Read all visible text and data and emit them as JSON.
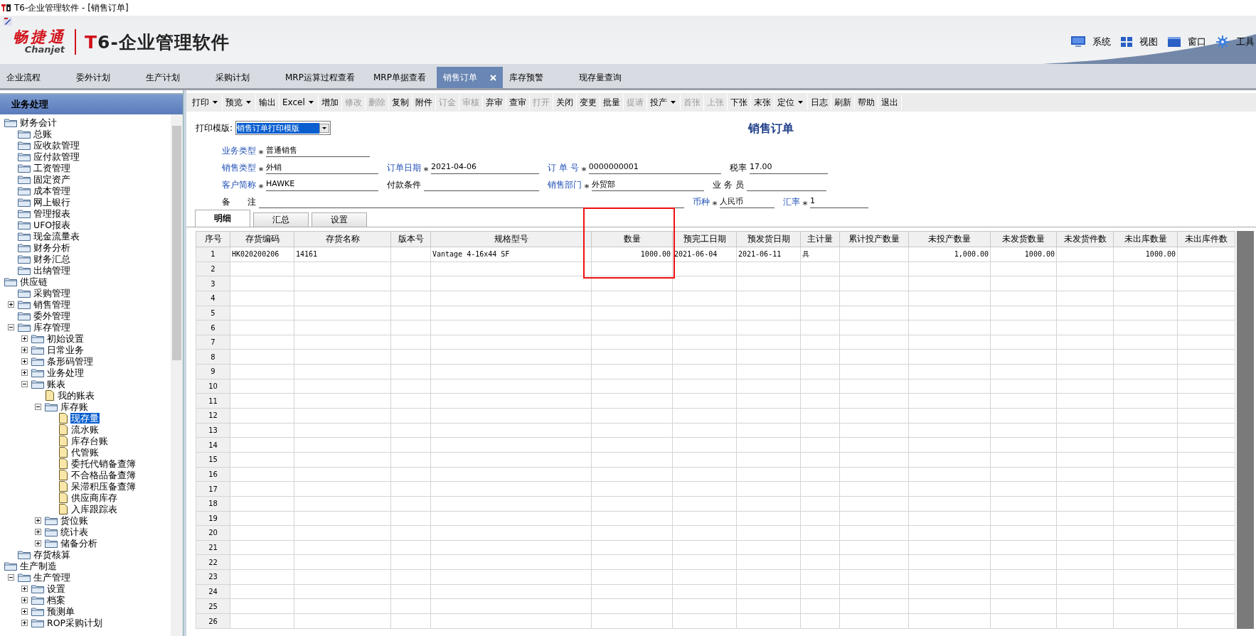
{
  "window": {
    "title": "T6-企业管理软件 - [销售订单]"
  },
  "header": {
    "brand": "畅捷通",
    "brand_sub": "Chanjet",
    "product": "T6-企业管理软件",
    "menu": [
      {
        "label": "系统",
        "kind": "monitor"
      },
      {
        "label": "视图",
        "kind": "grid"
      },
      {
        "label": "窗口",
        "kind": "window"
      },
      {
        "label": "工具",
        "kind": "gear"
      }
    ]
  },
  "tabs": [
    {
      "label": "企业流程",
      "selected": false,
      "closable": false
    },
    {
      "label": "委外计划",
      "selected": false,
      "closable": false
    },
    {
      "label": "生产计划",
      "selected": false,
      "closable": false
    },
    {
      "label": "采购计划",
      "selected": false,
      "closable": false
    },
    {
      "label": "MRP运算过程查看",
      "selected": false,
      "closable": false
    },
    {
      "label": "MRP单据查看",
      "selected": false,
      "closable": false
    },
    {
      "label": "销售订单",
      "selected": true,
      "closable": true
    },
    {
      "label": "库存预警",
      "selected": false,
      "closable": false
    },
    {
      "label": "现存量查询",
      "selected": false,
      "closable": false
    }
  ],
  "sidebar": {
    "title": "业务处理",
    "items": [
      {
        "label": "财务会计",
        "kind": "folder",
        "selected": false,
        "children": [
          {
            "label": "总账",
            "kind": "folder",
            "selected": false
          },
          {
            "label": "应收款管理",
            "kind": "folder",
            "selected": false
          },
          {
            "label": "应付款管理",
            "kind": "folder",
            "selected": false
          },
          {
            "label": "工资管理",
            "kind": "folder",
            "selected": false
          },
          {
            "label": "固定资产",
            "kind": "folder",
            "selected": false
          },
          {
            "label": "成本管理",
            "kind": "folder",
            "selected": false
          },
          {
            "label": "网上银行",
            "kind": "folder",
            "selected": false
          },
          {
            "label": "管理报表",
            "kind": "folder",
            "selected": false
          },
          {
            "label": "UFO报表",
            "kind": "folder",
            "selected": false
          },
          {
            "label": "现金流量表",
            "kind": "folder",
            "selected": false
          },
          {
            "label": "财务分析",
            "kind": "folder",
            "selected": false
          },
          {
            "label": "财务汇总",
            "kind": "folder",
            "selected": false
          },
          {
            "label": "出纳管理",
            "kind": "folder",
            "selected": false
          }
        ]
      },
      {
        "label": "供应链",
        "kind": "folder",
        "selected": false,
        "children": [
          {
            "label": "采购管理",
            "kind": "folder",
            "selected": false
          },
          {
            "label": "销售管理",
            "kind": "folder",
            "selected": false,
            "expanded": false
          },
          {
            "label": "委外管理",
            "kind": "folder",
            "selected": false
          },
          {
            "label": "库存管理",
            "kind": "folder",
            "selected": false,
            "expanded": true,
            "children": [
              {
                "label": "初始设置",
                "kind": "folder",
                "selected": false,
                "expanded": false
              },
              {
                "label": "日常业务",
                "kind": "folder",
                "selected": false,
                "expanded": false
              },
              {
                "label": "条形码管理",
                "kind": "folder",
                "selected": false,
                "expanded": false
              },
              {
                "label": "业务处理",
                "kind": "folder",
                "selected": false,
                "expanded": false
              },
              {
                "label": "账表",
                "kind": "folder",
                "selected": false,
                "expanded": true,
                "children": [
                  {
                    "label": "我的账表",
                    "kind": "document",
                    "selected": false
                  },
                  {
                    "label": "库存账",
                    "kind": "folder",
                    "selected": false,
                    "expanded": true,
                    "children": [
                      {
                        "label": "现存量",
                        "kind": "document",
                        "selected": true
                      },
                      {
                        "label": "流水账",
                        "kind": "document",
                        "selected": false
                      },
                      {
                        "label": "库存台账",
                        "kind": "document",
                        "selected": false
                      },
                      {
                        "label": "代管账",
                        "kind": "document",
                        "selected": false
                      },
                      {
                        "label": "委托代销备查簿",
                        "kind": "document",
                        "selected": false
                      },
                      {
                        "label": "不合格品备查簿",
                        "kind": "document",
                        "selected": false
                      },
                      {
                        "label": "呆滞积压备查簿",
                        "kind": "document",
                        "selected": false
                      },
                      {
                        "label": "供应商库存",
                        "kind": "document",
                        "selected": false
                      },
                      {
                        "label": "入库跟踪表",
                        "kind": "document",
                        "selected": false
                      }
                    ]
                  },
                  {
                    "label": "货位账",
                    "kind": "folder",
                    "selected": false,
                    "expanded": false
                  },
                  {
                    "label": "统计表",
                    "kind": "folder",
                    "selected": false,
                    "expanded": false
                  },
                  {
                    "label": "储备分析",
                    "kind": "folder",
                    "selected": false,
                    "expanded": false
                  }
                ]
              }
            ]
          },
          {
            "label": "存货核算",
            "kind": "folder",
            "selected": false
          }
        ]
      },
      {
        "label": "生产制造",
        "kind": "folder",
        "selected": false,
        "children": [
          {
            "label": "生产管理",
            "kind": "folder",
            "selected": false,
            "expanded": true,
            "children": [
              {
                "label": "设置",
                "kind": "folder",
                "selected": false,
                "expanded": false
              },
              {
                "label": "档案",
                "kind": "folder",
                "selected": false,
                "expanded": false
              },
              {
                "label": "预测单",
                "kind": "folder",
                "selected": false,
                "expanded": false
              },
              {
                "label": "ROP采购计划",
                "kind": "folder",
                "selected": false,
                "expanded": false
              }
            ]
          }
        ]
      }
    ]
  },
  "toolbar": [
    {
      "label": "打印",
      "disabled": false,
      "dropdown": true
    },
    {
      "label": "预览",
      "disabled": false,
      "dropdown": true
    },
    {
      "label": "输出",
      "disabled": false,
      "dropdown": false
    },
    {
      "label": "Excel",
      "disabled": false,
      "dropdown": true
    },
    {
      "label": "增加",
      "disabled": false,
      "dropdown": false
    },
    {
      "label": "修改",
      "disabled": true,
      "dropdown": false
    },
    {
      "label": "删除",
      "disabled": true,
      "dropdown": false
    },
    {
      "label": "复制",
      "disabled": false,
      "dropdown": false
    },
    {
      "label": "附件",
      "disabled": false,
      "dropdown": false
    },
    {
      "label": "订金",
      "disabled": true,
      "dropdown": false
    },
    {
      "label": "审核",
      "disabled": true,
      "dropdown": false
    },
    {
      "label": "弃审",
      "disabled": false,
      "dropdown": false
    },
    {
      "label": "查审",
      "disabled": false,
      "dropdown": false
    },
    {
      "label": "打开",
      "disabled": true,
      "dropdown": false
    },
    {
      "label": "关闭",
      "disabled": false,
      "dropdown": false
    },
    {
      "label": "变更",
      "disabled": false,
      "dropdown": false
    },
    {
      "label": "批量",
      "disabled": false,
      "dropdown": false
    },
    {
      "label": "提请",
      "disabled": true,
      "dropdown": false
    },
    {
      "label": "投产",
      "disabled": false,
      "dropdown": true
    },
    {
      "label": "首张",
      "disabled": true,
      "dropdown": false
    },
    {
      "label": "上张",
      "disabled": true,
      "dropdown": false
    },
    {
      "label": "下张",
      "disabled": false,
      "dropdown": false
    },
    {
      "label": "末张",
      "disabled": false,
      "dropdown": false
    },
    {
      "label": "定位",
      "disabled": false,
      "dropdown": true
    },
    {
      "label": "日志",
      "disabled": false,
      "dropdown": false
    },
    {
      "label": "刷新",
      "disabled": false,
      "dropdown": false
    },
    {
      "label": "帮助",
      "disabled": false,
      "dropdown": false
    },
    {
      "label": "退出",
      "disabled": false,
      "dropdown": false
    }
  ],
  "form": {
    "title": "销售订单",
    "template_label": "打印模版:",
    "template_value": "销售订单打印模版",
    "rows": [
      [
        {
          "label": "业务类型",
          "required": true,
          "value": "普通销售"
        }
      ],
      [
        {
          "label": "销售类型",
          "required": true,
          "value": "外销"
        },
        {
          "label": "订单日期",
          "required": true,
          "value": "2021-04-06"
        },
        {
          "label": "订 单 号",
          "required": true,
          "value": "0000000001"
        },
        {
          "label": "税率",
          "required": false,
          "value": "17.00"
        }
      ],
      [
        {
          "label": "客户简称",
          "required": true,
          "value": "HAWKE"
        },
        {
          "label": "付款条件",
          "required": false
        },
        {
          "label": "销售部门",
          "required": true,
          "value": "外贸部"
        },
        {
          "label": "业 务 员",
          "required": false
        }
      ],
      [
        {
          "label": "备　　注",
          "required": false
        },
        {
          "label": "币种",
          "required": true,
          "value": "人民币"
        },
        {
          "label": "汇率",
          "required": true,
          "value": "1"
        }
      ]
    ]
  },
  "sub_tabs": [
    {
      "label": "明细",
      "selected": true
    },
    {
      "label": "汇总",
      "selected": false
    },
    {
      "label": "设置",
      "selected": false
    }
  ],
  "table": {
    "columns": [
      {
        "label": "序号",
        "highlighted": false
      },
      {
        "label": "存货编码",
        "highlighted": false
      },
      {
        "label": "存货名称",
        "highlighted": false
      },
      {
        "label": "版本号",
        "highlighted": false
      },
      {
        "label": "规格型号",
        "highlighted": false
      },
      {
        "label": "数量",
        "highlighted": true
      },
      {
        "label": "预完工日期",
        "highlighted": false
      },
      {
        "label": "预发货日期",
        "highlighted": false
      },
      {
        "label": "主计量",
        "highlighted": false
      },
      {
        "label": "累计投产数量",
        "highlighted": false
      },
      {
        "label": "未投产数量",
        "highlighted": false
      },
      {
        "label": "未发货数量",
        "highlighted": false
      },
      {
        "label": "未发货件数",
        "highlighted": false
      },
      {
        "label": "未出库数量",
        "highlighted": false
      },
      {
        "label": "未出库件数",
        "highlighted": false
      }
    ],
    "rows": [
      [
        "1",
        "HK020200206",
        "14161",
        null,
        "Vantage 4-16x44 SF",
        "1000.00",
        "2021-06-04",
        "2021-06-11",
        "具",
        null,
        "1,000.00",
        "1000.00",
        null,
        "1000.00",
        null
      ],
      [
        "2"
      ],
      [
        "3"
      ],
      [
        "4"
      ],
      [
        "5"
      ],
      [
        "6"
      ],
      [
        "7"
      ],
      [
        "8"
      ],
      [
        "9"
      ],
      [
        "10"
      ],
      [
        "11"
      ],
      [
        "12"
      ],
      [
        "13"
      ],
      [
        "14"
      ],
      [
        "15"
      ],
      [
        "16"
      ],
      [
        "17"
      ],
      [
        "18"
      ],
      [
        "19"
      ],
      [
        "20"
      ],
      [
        "21"
      ],
      [
        "22"
      ],
      [
        "23"
      ],
      [
        "24"
      ],
      [
        "25"
      ],
      [
        "26"
      ]
    ]
  }
}
